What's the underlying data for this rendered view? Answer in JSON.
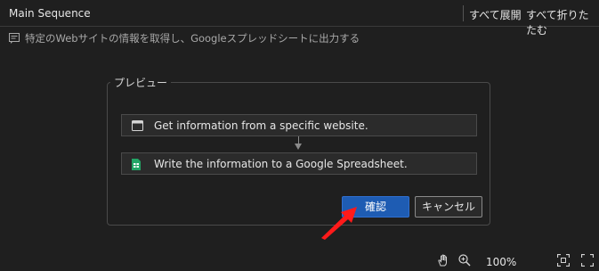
{
  "header": {
    "title": "Main Sequence",
    "expand_all": "すべて展開",
    "collapse_all": "すべて折りたたむ"
  },
  "description": "特定のWebサイトの情報を取得し、Googleスプレッドシートに出力する",
  "preview": {
    "legend": "プレビュー",
    "steps": [
      {
        "label": "Get information from a specific website.",
        "icon": "browser-window-icon"
      },
      {
        "label": "Write the information to a Google Spreadsheet.",
        "icon": "google-sheets-icon"
      }
    ]
  },
  "buttons": {
    "confirm": "確認",
    "cancel": "キャンセル"
  },
  "toolbar": {
    "zoom": "100%",
    "icons": [
      "hand-pan-icon",
      "zoom-in-icon",
      "fit-screen-icon",
      "fullscreen-icon"
    ]
  },
  "colors": {
    "background": "#1f1f1f",
    "primary_button": "#1e5cb3",
    "annotation_arrow": "#ff1a1a",
    "sheets_icon": "#23a566"
  }
}
